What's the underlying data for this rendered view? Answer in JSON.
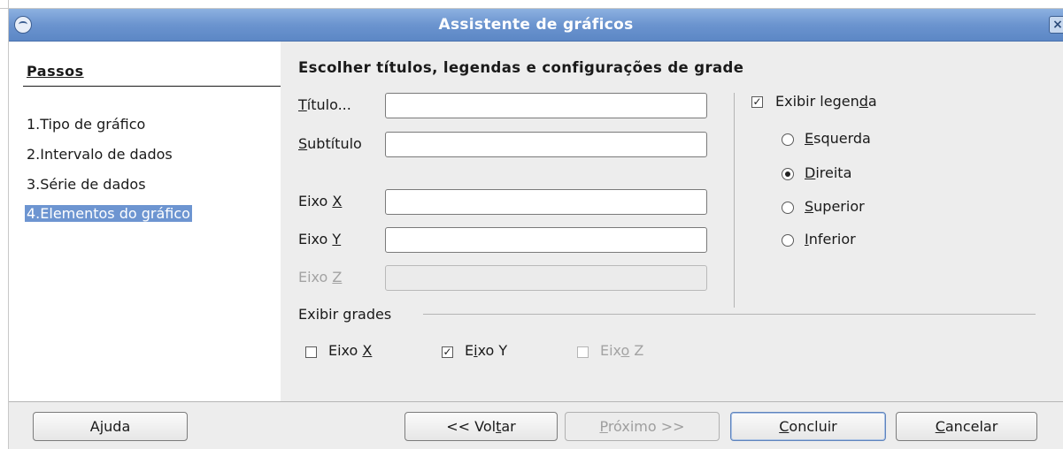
{
  "window": {
    "title": "Assistente de gráficos"
  },
  "steps": {
    "heading": "Passos",
    "items": [
      {
        "number": "1.",
        "label": "Tipo de gráfico"
      },
      {
        "number": "2.",
        "label": "Intervalo de dados"
      },
      {
        "number": "3.",
        "label": "Série de dados"
      },
      {
        "number": "4.",
        "label": "Elementos do gráfico",
        "selected": true
      }
    ]
  },
  "main": {
    "section_title": "Escolher títulos, legendas e configurações de grade",
    "fields": {
      "title": {
        "label": "Título...",
        "value": ""
      },
      "subtitle": {
        "label": "Subtítulo",
        "value": ""
      },
      "x_axis": {
        "label": "Eixo X",
        "value": ""
      },
      "y_axis": {
        "label": "Eixo Y",
        "value": ""
      },
      "z_axis": {
        "label": "Eixo Z",
        "value": "",
        "disabled": true
      }
    },
    "legend": {
      "label": "Exibir legenda",
      "checked": true,
      "selected": "Direita",
      "positions": [
        "Esquerda",
        "Direita",
        "Superior",
        "Inferior"
      ]
    },
    "grids": {
      "label": "Exibir grades",
      "x": {
        "label": "Eixo X",
        "checked": false
      },
      "y": {
        "label": "Eixo Y",
        "checked": true
      },
      "z": {
        "label": "Eixo Z",
        "checked": false,
        "disabled": true
      }
    }
  },
  "buttons": {
    "help": "Ajuda",
    "back": "<< Voltar",
    "next": "Próximo >>",
    "finish": "Concluir",
    "cancel": "Cancelar"
  },
  "colors": {
    "titlebar": "#6b94cf",
    "selection": "#6d95d1",
    "dialog_bg": "#ededed"
  }
}
